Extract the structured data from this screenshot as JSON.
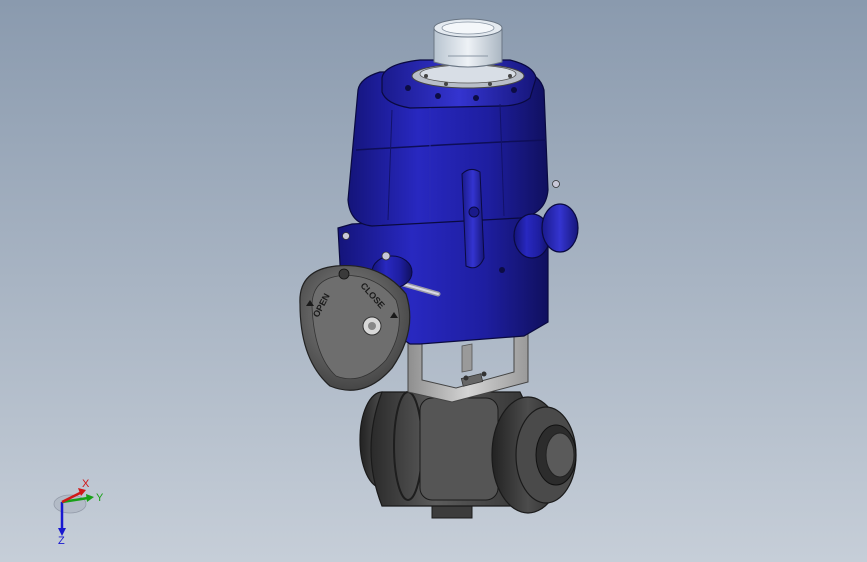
{
  "viewport": {
    "background_top": "#8a9aae",
    "background_bottom": "#c6ced8"
  },
  "model": {
    "actuator_color": "#1e1ea0",
    "valve_body_color": "#4a4a4a",
    "bracket_color": "#b4b4b4",
    "indicator_color": "#d8e0e8",
    "handwheel_color": "#5a5a5a",
    "handwheel_text": {
      "open": "OPEN",
      "close": "CLOSE"
    }
  },
  "triad": {
    "x_label": "X",
    "y_label": "Y",
    "z_label": "Z",
    "x_color": "#d01818",
    "y_color": "#18a018",
    "z_color": "#1818d0"
  }
}
